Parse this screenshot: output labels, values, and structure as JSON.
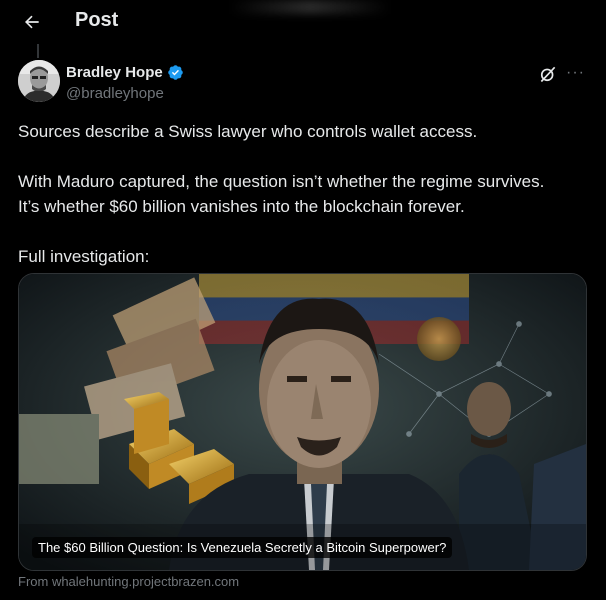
{
  "header": {
    "title": "Post",
    "back_icon": "arrow-left-icon"
  },
  "author": {
    "display_name": "Bradley Hope",
    "handle": "@bradleyhope",
    "verified": true,
    "verified_color": "#1d9bf0"
  },
  "actions": {
    "grok_icon": "grok-icon",
    "more_label": "···"
  },
  "post": {
    "text": "Sources describe a Swiss lawyer who controls wallet access.\n\nWith Maduro captured, the question isn’t whether the regime survives.\nIt’s whether $60 billion vanishes into the blockchain forever.\n\nFull investigation:"
  },
  "link_card": {
    "title": "The $60 Billion Question: Is Venezuela Secretly a Bitcoin Superpower?",
    "source": "From whalehunting.projectbrazen.com"
  },
  "colors": {
    "background": "#000000",
    "text_primary": "#e7e9ea",
    "text_secondary": "#71767b",
    "accent": "#1d9bf0"
  }
}
